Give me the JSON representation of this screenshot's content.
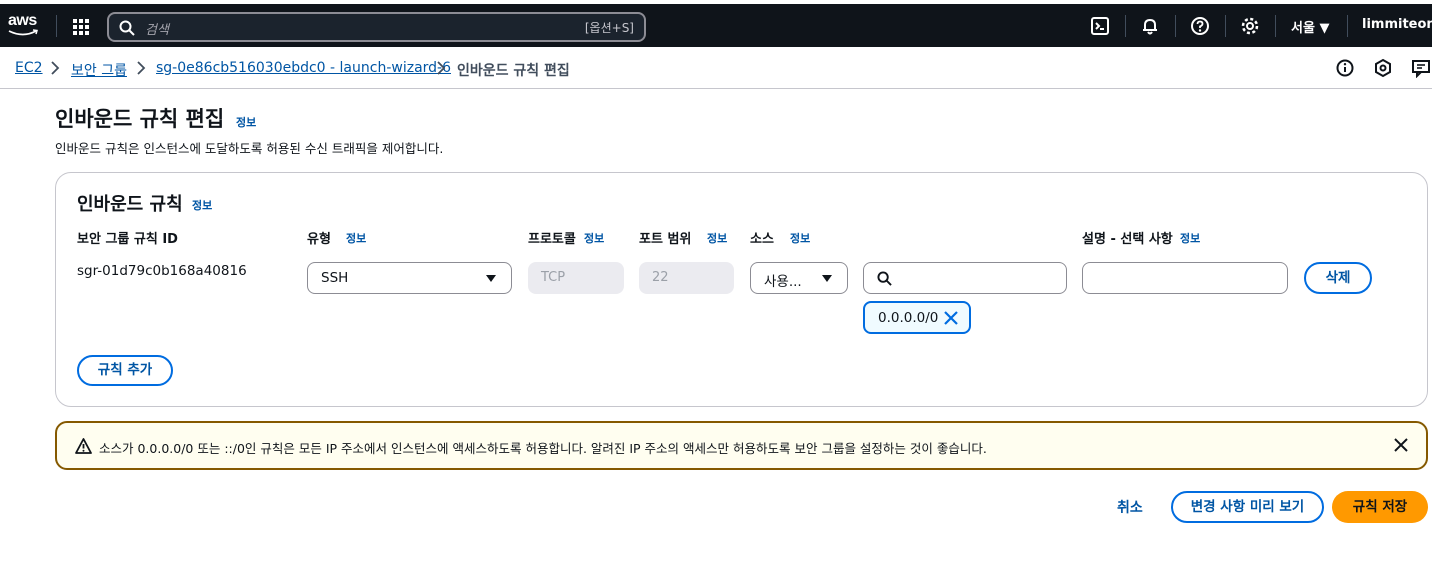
{
  "topnav": {
    "logo_text": "aws",
    "search_placeholder": "검색",
    "search_shortcut": "[옵션+S]",
    "region": "서울 ▼",
    "account": "limmiteon ▼",
    "icons": [
      "apps-grid-icon",
      "search-icon",
      "cloudshell-icon",
      "bell-icon",
      "help-icon",
      "gear-icon"
    ],
    "colors": {
      "bg": "#0f141a",
      "accent": "#ff9900"
    }
  },
  "breadcrumb": {
    "items": [
      "EC2",
      "보안 그룹",
      "sg-0e86cb516030ebdc0 - launch-wizard-6",
      "인바운드 규칙 편집"
    ],
    "utility_icons": [
      "info-icon",
      "notifications-icon",
      "feedback-icon"
    ]
  },
  "page": {
    "title": "인바운드 규칙 편집",
    "info": "정보",
    "description": "인바운드 규칙은 인스턴스에 도달하도록 허용된 수신 트래픽을 제어합니다."
  },
  "rules_panel": {
    "title": "인바운드 규칙",
    "info": "정보",
    "columns": {
      "rule_id": "보안 그룹 규칙 ID",
      "type": "유형",
      "protocol": "프로토콜",
      "port_range": "포트 범위",
      "source": "소스",
      "description": "설명 - 선택 사항",
      "info": "정보"
    },
    "rows": [
      {
        "rule_id": "sgr-01d79c0b168a40816",
        "type": "SSH",
        "protocol": "TCP",
        "port_range": "22",
        "source_type": "사용...",
        "source_search": "",
        "source_token": "0.0.0.0/0",
        "description": "",
        "delete_label": "삭제"
      }
    ],
    "add_rule_label": "규칙 추가"
  },
  "alert": {
    "type": "warning",
    "message": "소스가 0.0.0.0/0 또는 ::/0인 규칙은 모든 IP 주소에서 인스턴스에 액세스하도록 허용합니다. 알려진 IP 주소의 액세스만 허용하도록 보안 그룹을 설정하는 것이 좋습니다."
  },
  "footer": {
    "cancel_label": "취소",
    "preview_label": "변경 사항 미리 보기",
    "save_label": "규칙 저장"
  }
}
